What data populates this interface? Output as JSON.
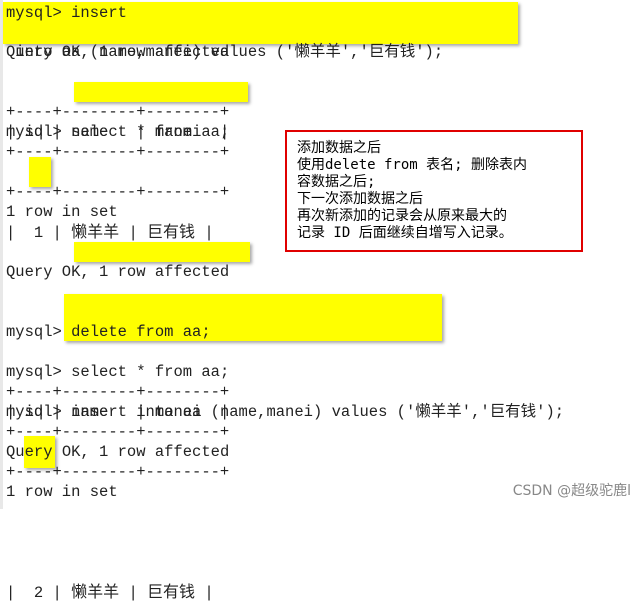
{
  "terminal": {
    "block1": {
      "prompt": "mysql> ",
      "cmd_line1": "insert",
      "cmd_line2": " into aa (name,manei) values ('懒羊羊','巨有钱');",
      "result": "Query OK, 1 row affected"
    },
    "block2": {
      "prompt": "mysql> ",
      "cmd": "select * from aa;",
      "border": "+----+--------+--------+",
      "headers": [
        "id",
        "name",
        "manei"
      ],
      "row": {
        "id": "1",
        "name": "懒羊羊",
        "manei": "巨有钱"
      },
      "footer": "1 row in set"
    },
    "block3": {
      "prompt": "mysql> ",
      "cmd": "delete from aa;",
      "result": "Query OK, 1 row affected"
    },
    "block4": {
      "prompt": "mysql> ",
      "cmd": "insert into aa (name,manei) values ('懒羊羊','巨有钱');",
      "result_prefix": "Query ",
      "result": "OK, 1 row affected"
    },
    "block5": {
      "prompt": "mysql> ",
      "cmd": "select * from aa;",
      "border": "+----+--------+--------+",
      "headers": [
        "id",
        "name",
        "manei"
      ],
      "row": {
        "id": "2",
        "name": "懒羊羊",
        "manei": "巨有钱"
      },
      "footer": "1 row in set"
    }
  },
  "note": {
    "lines": [
      "添加数据之后",
      "使用delete from 表名; 删除表内",
      "容数据之后;",
      "下一次添加数据之后",
      "再次新添加的记录会从原来最大的",
      "记录 ID 后面继续自增写入记录。"
    ]
  },
  "watermark": "CSDN @超级驼鹿l",
  "colors": {
    "highlight": "#ffff00",
    "note_border": "#e00000"
  }
}
